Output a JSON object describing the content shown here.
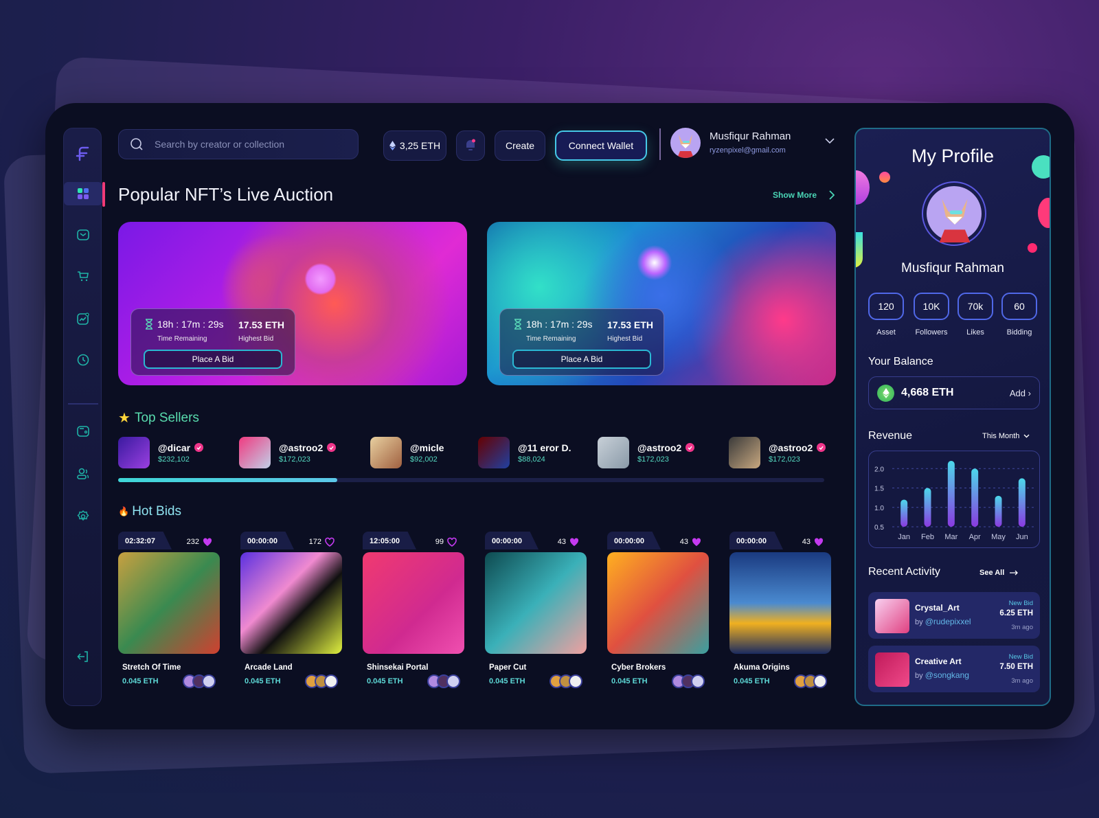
{
  "header": {
    "search_placeholder": "Search by creator or collection",
    "eth_balance": "3,25 ETH",
    "create_label": "Create",
    "connect_wallet_label": "Connect Wallet",
    "user_name": "Musfiqur Rahman",
    "user_email": "ryzenpixel@gmail.com"
  },
  "sidebar": {
    "items": [
      "dashboard",
      "messages",
      "marketplace",
      "analytics",
      "history",
      "wallet",
      "users",
      "settings",
      "logout"
    ],
    "active": "dashboard"
  },
  "auction": {
    "title": "Popular NFT’s Live Auction",
    "show_more": "Show More",
    "cards": [
      {
        "time": "18h : 17m : 29s",
        "time_label": "Time Remaining",
        "bid": "17.53 ETH",
        "bid_label": "Highest Bid",
        "button": "Place A Bid"
      },
      {
        "time": "18h : 17m : 29s",
        "time_label": "Time Remaining",
        "bid": "17.53 ETH",
        "bid_label": "Highest Bid",
        "button": "Place A Bid"
      }
    ]
  },
  "top_sellers": {
    "title": "Top Sellers",
    "scroll_progress": 0.31,
    "items": [
      {
        "handle": "@dicar",
        "amount": "$232,102",
        "verified": true
      },
      {
        "handle": "@astroo2",
        "amount": "$172,023",
        "verified": true
      },
      {
        "handle": "@micle",
        "amount": "$92,002",
        "verified": false
      },
      {
        "handle": "@11 eror D.",
        "amount": "$88,024",
        "verified": false
      },
      {
        "handle": "@astroo2",
        "amount": "$172,023",
        "verified": true
      },
      {
        "handle": "@astroo2",
        "amount": "$172,023",
        "verified": true
      }
    ]
  },
  "hot_bids": {
    "title": "Hot Bids",
    "items": [
      {
        "time": "02:32:07",
        "likes": "232",
        "liked": true,
        "name": "Stretch Of Time",
        "price": "0.045 ETH"
      },
      {
        "time": "00:00:00",
        "likes": "172",
        "liked": false,
        "name": "Arcade Land",
        "price": "0.045 ETH"
      },
      {
        "time": "12:05:00",
        "likes": "99",
        "liked": false,
        "name": "Shinsekai Portal",
        "price": "0.045 ETH"
      },
      {
        "time": "00:00:00",
        "likes": "43",
        "liked": true,
        "name": "Paper Cut",
        "price": "0.045 ETH"
      },
      {
        "time": "00:00:00",
        "likes": "43",
        "liked": true,
        "name": "Cyber Brokers",
        "price": "0.045 ETH"
      },
      {
        "time": "00:00:00",
        "likes": "43",
        "liked": true,
        "name": "Akuma Origins",
        "price": "0.045 ETH"
      }
    ]
  },
  "profile": {
    "title": "My Profile",
    "name": "Musfiqur Rahman",
    "stats": [
      {
        "value": "120",
        "label": "Asset"
      },
      {
        "value": "10K",
        "label": "Followers"
      },
      {
        "value": "70k",
        "label": "Likes"
      },
      {
        "value": "60",
        "label": "Bidding"
      }
    ],
    "balance_title": "Your Balance",
    "balance": "4,668 ETH",
    "add_label": "Add",
    "revenue_title": "Revenue",
    "revenue_period": "This Month",
    "recent_title": "Recent Activity",
    "see_all": "See All",
    "activity": [
      {
        "title": "Crystal_Art",
        "by": "by",
        "user": "@rudepixxel",
        "tag": "New Bid",
        "eth": "6.25 ETH",
        "ago": "3m ago"
      },
      {
        "title": "Creative Art",
        "by": "by",
        "user": "@songkang",
        "tag": "New Bid",
        "eth": "7.50 ETH",
        "ago": "3m ago"
      }
    ]
  },
  "chart_data": {
    "type": "bar",
    "title": "Revenue",
    "categories": [
      "Jan",
      "Feb",
      "Mar",
      "Apr",
      "May",
      "Jun"
    ],
    "values": [
      1.2,
      1.5,
      2.2,
      2.0,
      1.3,
      1.75
    ],
    "yticks": [
      0.5,
      1.0,
      1.5,
      2.0
    ],
    "ylim": [
      0.5,
      2.2
    ],
    "grid": true,
    "xlabel": "",
    "ylabel": ""
  }
}
